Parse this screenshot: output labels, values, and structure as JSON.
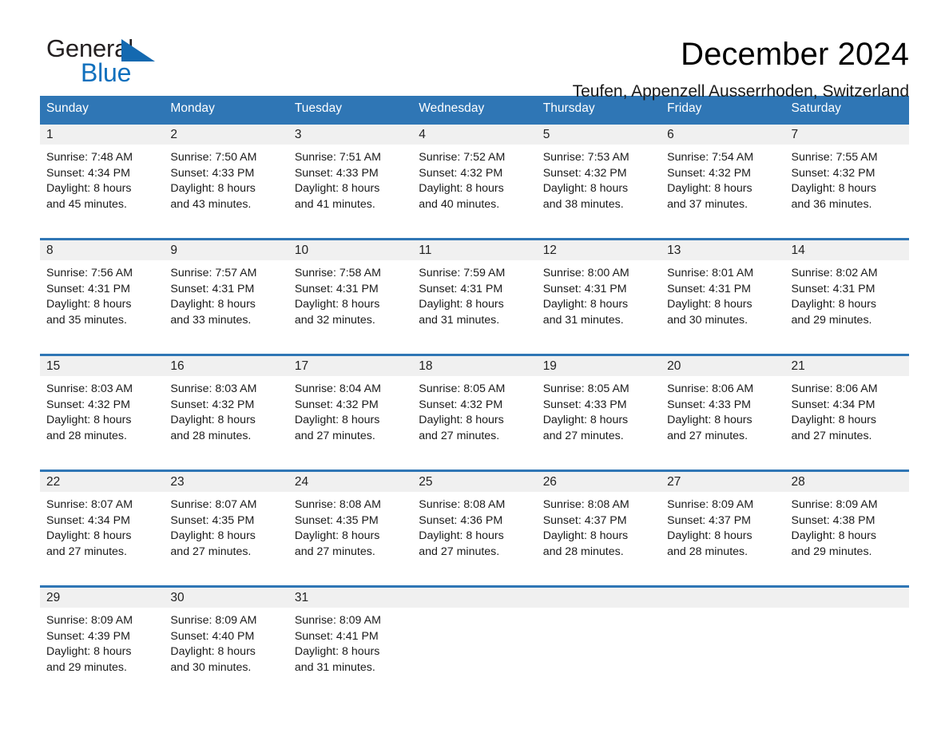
{
  "brand": {
    "name_part1": "General",
    "name_part2": "Blue",
    "triangle_color": "#1469b0",
    "blue_color": "#0f70bd"
  },
  "header": {
    "title": "December 2024",
    "location": "Teufen, Appenzell Ausserrhoden, Switzerland"
  },
  "theme": {
    "header_blue": "#2f76b5",
    "daynum_band": "#f0f0f0",
    "text": "#1a1a1a"
  },
  "weekdays": [
    "Sunday",
    "Monday",
    "Tuesday",
    "Wednesday",
    "Thursday",
    "Friday",
    "Saturday"
  ],
  "weeks": [
    [
      {
        "day": "1",
        "sunrise": "Sunrise: 7:48 AM",
        "sunset": "Sunset: 4:34 PM",
        "daylight1": "Daylight: 8 hours",
        "daylight2": "and 45 minutes."
      },
      {
        "day": "2",
        "sunrise": "Sunrise: 7:50 AM",
        "sunset": "Sunset: 4:33 PM",
        "daylight1": "Daylight: 8 hours",
        "daylight2": "and 43 minutes."
      },
      {
        "day": "3",
        "sunrise": "Sunrise: 7:51 AM",
        "sunset": "Sunset: 4:33 PM",
        "daylight1": "Daylight: 8 hours",
        "daylight2": "and 41 minutes."
      },
      {
        "day": "4",
        "sunrise": "Sunrise: 7:52 AM",
        "sunset": "Sunset: 4:32 PM",
        "daylight1": "Daylight: 8 hours",
        "daylight2": "and 40 minutes."
      },
      {
        "day": "5",
        "sunrise": "Sunrise: 7:53 AM",
        "sunset": "Sunset: 4:32 PM",
        "daylight1": "Daylight: 8 hours",
        "daylight2": "and 38 minutes."
      },
      {
        "day": "6",
        "sunrise": "Sunrise: 7:54 AM",
        "sunset": "Sunset: 4:32 PM",
        "daylight1": "Daylight: 8 hours",
        "daylight2": "and 37 minutes."
      },
      {
        "day": "7",
        "sunrise": "Sunrise: 7:55 AM",
        "sunset": "Sunset: 4:32 PM",
        "daylight1": "Daylight: 8 hours",
        "daylight2": "and 36 minutes."
      }
    ],
    [
      {
        "day": "8",
        "sunrise": "Sunrise: 7:56 AM",
        "sunset": "Sunset: 4:31 PM",
        "daylight1": "Daylight: 8 hours",
        "daylight2": "and 35 minutes."
      },
      {
        "day": "9",
        "sunrise": "Sunrise: 7:57 AM",
        "sunset": "Sunset: 4:31 PM",
        "daylight1": "Daylight: 8 hours",
        "daylight2": "and 33 minutes."
      },
      {
        "day": "10",
        "sunrise": "Sunrise: 7:58 AM",
        "sunset": "Sunset: 4:31 PM",
        "daylight1": "Daylight: 8 hours",
        "daylight2": "and 32 minutes."
      },
      {
        "day": "11",
        "sunrise": "Sunrise: 7:59 AM",
        "sunset": "Sunset: 4:31 PM",
        "daylight1": "Daylight: 8 hours",
        "daylight2": "and 31 minutes."
      },
      {
        "day": "12",
        "sunrise": "Sunrise: 8:00 AM",
        "sunset": "Sunset: 4:31 PM",
        "daylight1": "Daylight: 8 hours",
        "daylight2": "and 31 minutes."
      },
      {
        "day": "13",
        "sunrise": "Sunrise: 8:01 AM",
        "sunset": "Sunset: 4:31 PM",
        "daylight1": "Daylight: 8 hours",
        "daylight2": "and 30 minutes."
      },
      {
        "day": "14",
        "sunrise": "Sunrise: 8:02 AM",
        "sunset": "Sunset: 4:31 PM",
        "daylight1": "Daylight: 8 hours",
        "daylight2": "and 29 minutes."
      }
    ],
    [
      {
        "day": "15",
        "sunrise": "Sunrise: 8:03 AM",
        "sunset": "Sunset: 4:32 PM",
        "daylight1": "Daylight: 8 hours",
        "daylight2": "and 28 minutes."
      },
      {
        "day": "16",
        "sunrise": "Sunrise: 8:03 AM",
        "sunset": "Sunset: 4:32 PM",
        "daylight1": "Daylight: 8 hours",
        "daylight2": "and 28 minutes."
      },
      {
        "day": "17",
        "sunrise": "Sunrise: 8:04 AM",
        "sunset": "Sunset: 4:32 PM",
        "daylight1": "Daylight: 8 hours",
        "daylight2": "and 27 minutes."
      },
      {
        "day": "18",
        "sunrise": "Sunrise: 8:05 AM",
        "sunset": "Sunset: 4:32 PM",
        "daylight1": "Daylight: 8 hours",
        "daylight2": "and 27 minutes."
      },
      {
        "day": "19",
        "sunrise": "Sunrise: 8:05 AM",
        "sunset": "Sunset: 4:33 PM",
        "daylight1": "Daylight: 8 hours",
        "daylight2": "and 27 minutes."
      },
      {
        "day": "20",
        "sunrise": "Sunrise: 8:06 AM",
        "sunset": "Sunset: 4:33 PM",
        "daylight1": "Daylight: 8 hours",
        "daylight2": "and 27 minutes."
      },
      {
        "day": "21",
        "sunrise": "Sunrise: 8:06 AM",
        "sunset": "Sunset: 4:34 PM",
        "daylight1": "Daylight: 8 hours",
        "daylight2": "and 27 minutes."
      }
    ],
    [
      {
        "day": "22",
        "sunrise": "Sunrise: 8:07 AM",
        "sunset": "Sunset: 4:34 PM",
        "daylight1": "Daylight: 8 hours",
        "daylight2": "and 27 minutes."
      },
      {
        "day": "23",
        "sunrise": "Sunrise: 8:07 AM",
        "sunset": "Sunset: 4:35 PM",
        "daylight1": "Daylight: 8 hours",
        "daylight2": "and 27 minutes."
      },
      {
        "day": "24",
        "sunrise": "Sunrise: 8:08 AM",
        "sunset": "Sunset: 4:35 PM",
        "daylight1": "Daylight: 8 hours",
        "daylight2": "and 27 minutes."
      },
      {
        "day": "25",
        "sunrise": "Sunrise: 8:08 AM",
        "sunset": "Sunset: 4:36 PM",
        "daylight1": "Daylight: 8 hours",
        "daylight2": "and 27 minutes."
      },
      {
        "day": "26",
        "sunrise": "Sunrise: 8:08 AM",
        "sunset": "Sunset: 4:37 PM",
        "daylight1": "Daylight: 8 hours",
        "daylight2": "and 28 minutes."
      },
      {
        "day": "27",
        "sunrise": "Sunrise: 8:09 AM",
        "sunset": "Sunset: 4:37 PM",
        "daylight1": "Daylight: 8 hours",
        "daylight2": "and 28 minutes."
      },
      {
        "day": "28",
        "sunrise": "Sunrise: 8:09 AM",
        "sunset": "Sunset: 4:38 PM",
        "daylight1": "Daylight: 8 hours",
        "daylight2": "and 29 minutes."
      }
    ],
    [
      {
        "day": "29",
        "sunrise": "Sunrise: 8:09 AM",
        "sunset": "Sunset: 4:39 PM",
        "daylight1": "Daylight: 8 hours",
        "daylight2": "and 29 minutes."
      },
      {
        "day": "30",
        "sunrise": "Sunrise: 8:09 AM",
        "sunset": "Sunset: 4:40 PM",
        "daylight1": "Daylight: 8 hours",
        "daylight2": "and 30 minutes."
      },
      {
        "day": "31",
        "sunrise": "Sunrise: 8:09 AM",
        "sunset": "Sunset: 4:41 PM",
        "daylight1": "Daylight: 8 hours",
        "daylight2": "and 31 minutes."
      },
      {
        "day": "",
        "sunrise": "",
        "sunset": "",
        "daylight1": "",
        "daylight2": ""
      },
      {
        "day": "",
        "sunrise": "",
        "sunset": "",
        "daylight1": "",
        "daylight2": ""
      },
      {
        "day": "",
        "sunrise": "",
        "sunset": "",
        "daylight1": "",
        "daylight2": ""
      },
      {
        "day": "",
        "sunrise": "",
        "sunset": "",
        "daylight1": "",
        "daylight2": ""
      }
    ]
  ]
}
